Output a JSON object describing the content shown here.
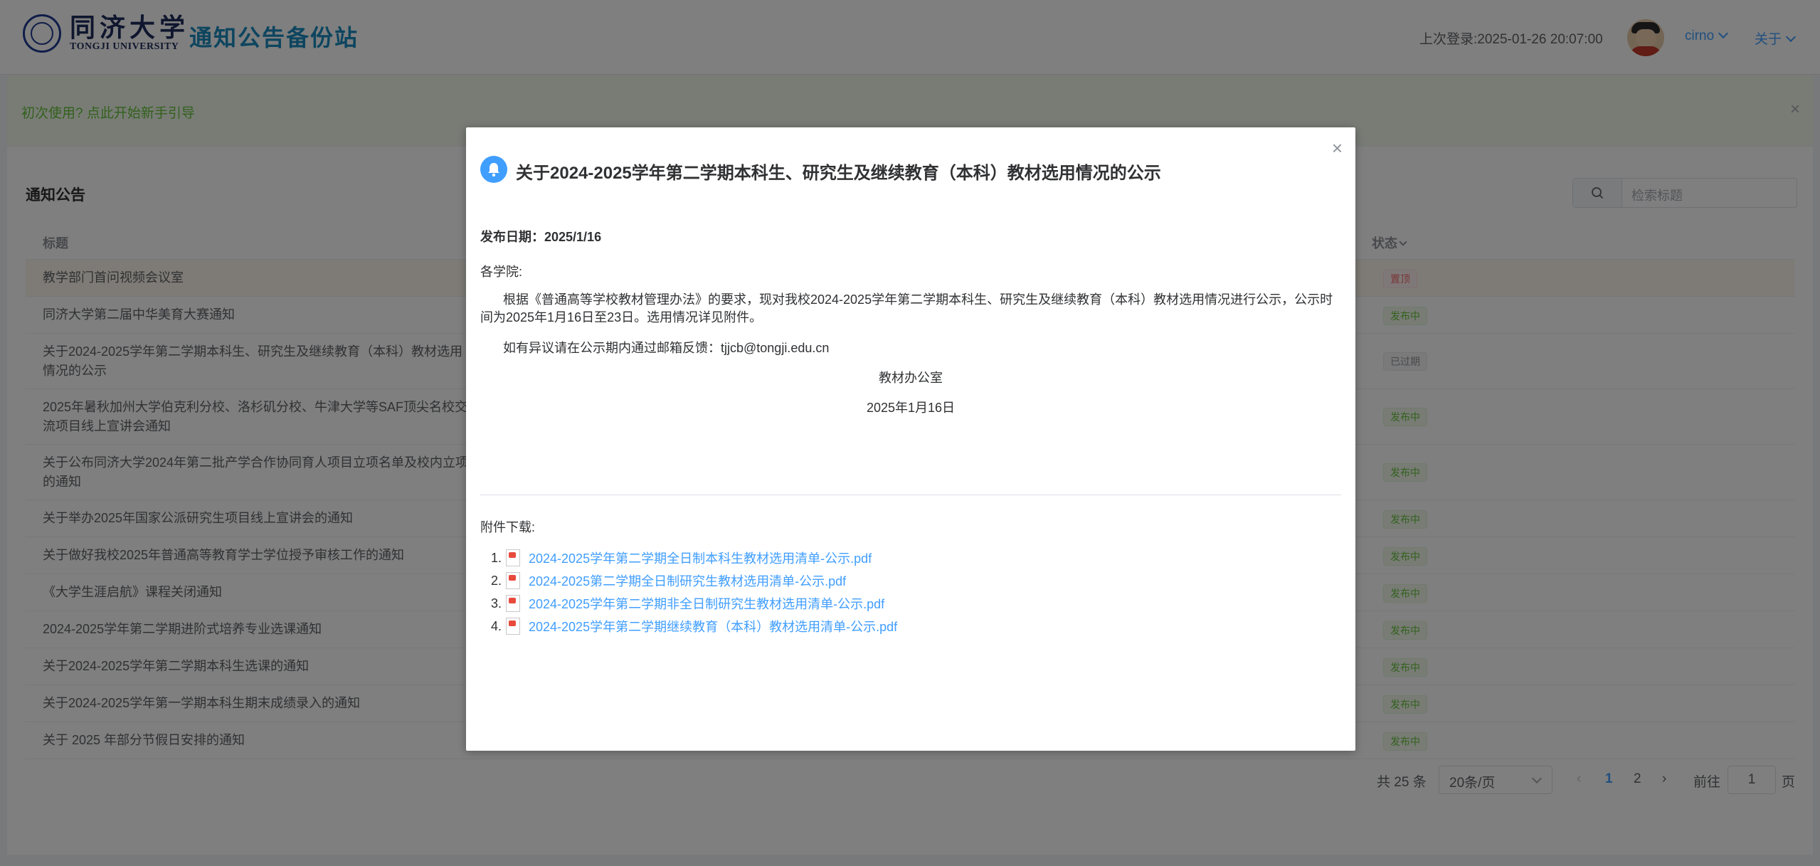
{
  "header": {
    "logo_cn": "同济大学",
    "logo_en": "TONGJI UNIVERSITY",
    "site_title": "通知公告备份站",
    "last_login_label": "上次登录:",
    "last_login_time": "2025-01-26 20:07:00",
    "username": "cirno",
    "about_label": "关于"
  },
  "guide": {
    "text": "初次使用? 点此开始新手引导",
    "close_icon": "×"
  },
  "main": {
    "title": "通知公告",
    "search_placeholder": "检索标题",
    "columns": {
      "title": "标题",
      "status": "状态"
    },
    "rows": [
      {
        "title": "教学部门首问视频会议室",
        "status": "置顶"
      },
      {
        "title": "同济大学第二届中华美育大赛通知",
        "status": "发布中"
      },
      {
        "title": "关于2024-2025学年第二学期本科生、研究生及继续教育（本科）教材选用情况的公示",
        "status": "已过期"
      },
      {
        "title": "2025年暑秋加州大学伯克利分校、洛杉矶分校、牛津大学等SAF顶尖名校交流项目线上宣讲会通知",
        "status": "发布中"
      },
      {
        "title": "关于公布同济大学2024年第二批产学合作协同育人项目立项名单及校内立项的通知",
        "status": "发布中"
      },
      {
        "title": "关于举办2025年国家公派研究生项目线上宣讲会的通知",
        "status": "发布中"
      },
      {
        "title": "关于做好我校2025年普通高等教育学士学位授予审核工作的通知",
        "status": "发布中"
      },
      {
        "title": "《大学生涯启航》课程关闭通知",
        "status": "发布中"
      },
      {
        "title": "2024-2025学年第二学期进阶式培养专业选课通知",
        "status": "发布中"
      },
      {
        "title": "关于2024-2025学年第二学期本科生选课的通知",
        "status": "发布中"
      },
      {
        "title": "关于2024-2025学年第一学期本科生期末成绩录入的通知",
        "status": "发布中"
      },
      {
        "title": "关于 2025 年部分节假日安排的通知",
        "status": "发布中"
      }
    ]
  },
  "pagination": {
    "total": "共 25 条",
    "page_size": "20条/页",
    "prev": "‹",
    "page1": "1",
    "page2": "2",
    "next": "›",
    "goto_label": "前往",
    "goto_value": "1",
    "goto_suffix": "页"
  },
  "modal": {
    "close_icon": "×",
    "title": "关于2024-2025学年第二学期本科生、研究生及继续教育（本科）教材选用情况的公示",
    "date": "发布日期：2025/1/16",
    "greeting": "各学院:",
    "paragraph": "根据《普通高等学校教材管理办法》的要求，现对我校2024-2025学年第二学期本科生、研究生及继续教育（本科）教材选用情况进行公示，公示时间为2025年1月16日至23日。选用情况详见附件。",
    "paragraph2": "如有异议请在公示期内通过邮箱反馈：tjjcb@tongji.edu.cn",
    "signature": "教材办公室",
    "sign_date": "2025年1月16日",
    "attachments_label": "附件下载:",
    "attachments": [
      {
        "num": "1.",
        "name": "2024-2025学年第二学期全日制本科生教材选用清单-公示.pdf"
      },
      {
        "num": "2.",
        "name": "2024-2025第二学期全日制研究生教材选用清单-公示.pdf"
      },
      {
        "num": "3.",
        "name": "2024-2025学年第二学期非全日制研究生教材选用清单-公示.pdf"
      },
      {
        "num": "4.",
        "name": "2024-2025学年第二学期继续教育（本科）教材选用清单-公示.pdf"
      }
    ]
  },
  "colors": {
    "primary": "#409eff",
    "success": "#67c23a",
    "danger": "#f56c6c",
    "site_title": "#1a8bbf"
  }
}
